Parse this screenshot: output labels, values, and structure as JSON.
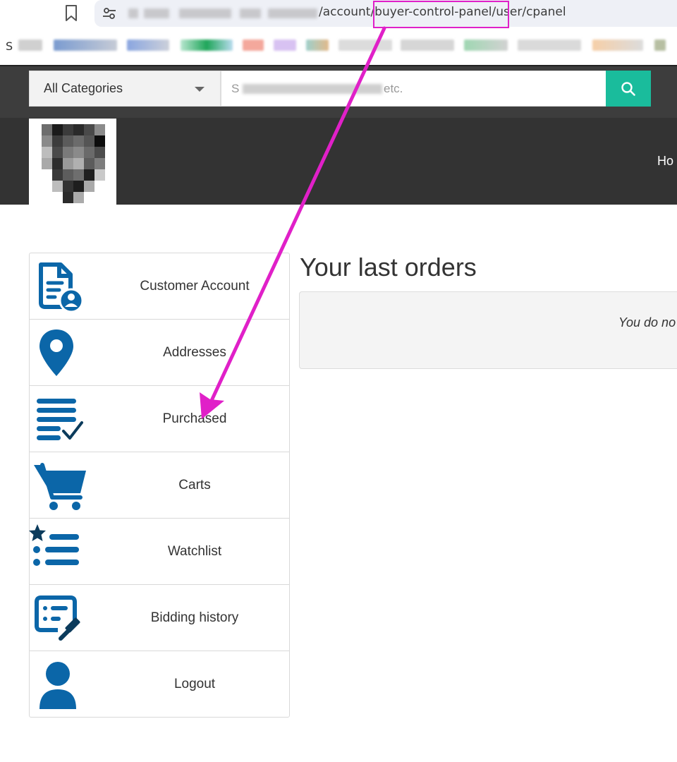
{
  "browser": {
    "url_visible": "/account/buyer-control-panel/user/cpanel",
    "bookmark_first_letter": "S"
  },
  "header": {
    "category_select": "All Categories",
    "search_placeholder_start": "S",
    "search_placeholder_end": "etc.",
    "nav_partial": "Ho",
    "accent_color": "#1abc9c"
  },
  "sidebar": {
    "icon_color": "#0b66a8",
    "items": [
      {
        "label": "Customer Account",
        "icon": "document-user-icon"
      },
      {
        "label": "Addresses",
        "icon": "map-pin-icon"
      },
      {
        "label": "Purchased",
        "icon": "list-check-icon"
      },
      {
        "label": "Carts",
        "icon": "cart-icon"
      },
      {
        "label": "Watchlist",
        "icon": "star-list-icon"
      },
      {
        "label": "Bidding history",
        "icon": "gavel-list-icon"
      },
      {
        "label": "Logout",
        "icon": "user-icon"
      }
    ]
  },
  "main": {
    "title": "Your last orders",
    "notice_partial": "You do no"
  },
  "annotation": {
    "color": "#e020c8"
  }
}
